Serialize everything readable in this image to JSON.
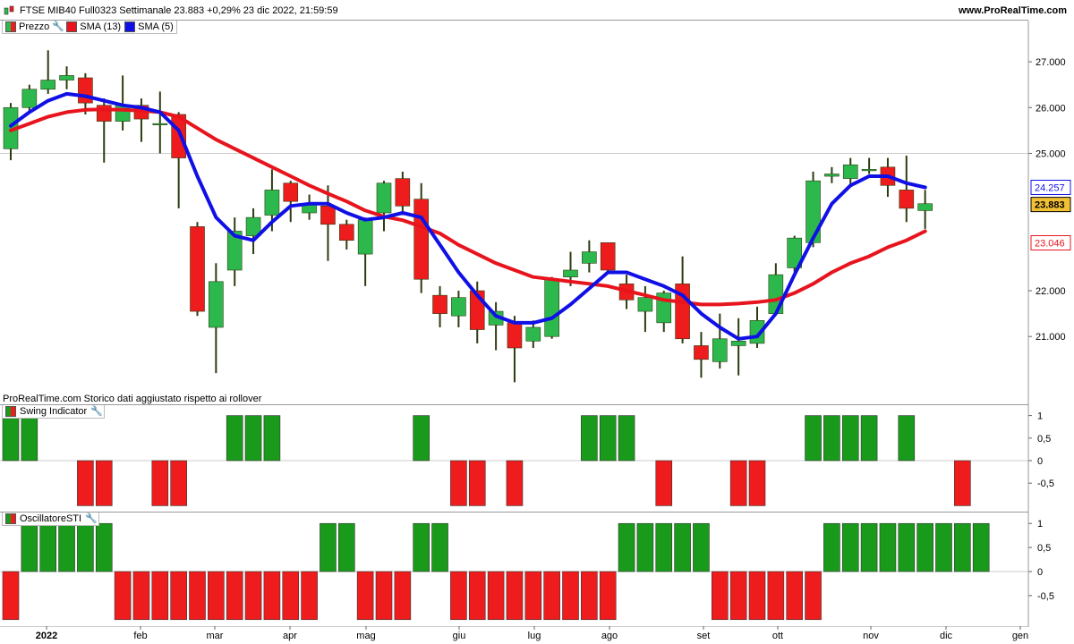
{
  "header": {
    "title": "FTSE MIB40 Full0323 Settimanale 23.883 +0,29% 23 dic 2022, 21:59:59",
    "brand": "www.ProRealTime.com"
  },
  "legend_price": {
    "price_label": "Prezzo",
    "sma13_label": "SMA (13)",
    "sma5_label": "SMA (5)"
  },
  "notice": "ProRealTime.com  Storico dati aggiustato rispetto ai rollover",
  "legend_swing": "Swing Indicator",
  "legend_osc": "OscillatoreSTI",
  "colors": {
    "up": "#2db84d",
    "down": "#ee1c1c",
    "sma13": "#e8141d",
    "sma5": "#1010e6",
    "bar_up": "#1a9a1a",
    "bar_down": "#ee1c1c"
  },
  "price_axis": {
    "ticks": [
      "27.000",
      "26.000",
      "25.000",
      "22.000",
      "21.000"
    ],
    "tick_values": [
      27000,
      26000,
      25000,
      22000,
      21000
    ],
    "last_price": "23.883",
    "sma5_last": "24.257",
    "sma13_last": "23.046"
  },
  "swing_axis": [
    "1",
    "0,5",
    "0",
    "-0,5"
  ],
  "osc_axis": [
    "1",
    "0,5",
    "0",
    "-0,5"
  ],
  "x_labels": [
    "2022",
    "feb",
    "mar",
    "apr",
    "mag",
    "giu",
    "lug",
    "ago",
    "set",
    "ott",
    "nov",
    "dic",
    "gen"
  ],
  "chart_data": [
    {
      "type": "candlestick",
      "candles": [
        {
          "o": 25100,
          "c": 26000,
          "h": 26100,
          "l": 24850
        },
        {
          "o": 26000,
          "c": 26400,
          "h": 26500,
          "l": 25900
        },
        {
          "o": 26400,
          "c": 26600,
          "h": 27250,
          "l": 26300
        },
        {
          "o": 26600,
          "c": 26700,
          "h": 26900,
          "l": 26400
        },
        {
          "o": 26650,
          "c": 26100,
          "h": 26750,
          "l": 25850
        },
        {
          "o": 26050,
          "c": 25700,
          "h": 26200,
          "l": 24800
        },
        {
          "o": 25700,
          "c": 26050,
          "h": 26700,
          "l": 25500
        },
        {
          "o": 26050,
          "c": 25750,
          "h": 26200,
          "l": 25250
        },
        {
          "o": 25650,
          "c": 25650,
          "h": 26350,
          "l": 25000
        },
        {
          "o": 25850,
          "c": 24900,
          "h": 25900,
          "l": 23800
        },
        {
          "o": 23400,
          "c": 21550,
          "h": 23500,
          "l": 21450
        },
        {
          "o": 21200,
          "c": 22200,
          "h": 22600,
          "l": 20200
        },
        {
          "o": 22450,
          "c": 23300,
          "h": 23600,
          "l": 22100
        },
        {
          "o": 23200,
          "c": 23600,
          "h": 23800,
          "l": 22800
        },
        {
          "o": 23650,
          "c": 24200,
          "h": 24650,
          "l": 23300
        },
        {
          "o": 24350,
          "c": 23950,
          "h": 24400,
          "l": 23500
        },
        {
          "o": 23700,
          "c": 23900,
          "h": 24100,
          "l": 23550
        },
        {
          "o": 23850,
          "c": 23450,
          "h": 24300,
          "l": 22650
        },
        {
          "o": 23450,
          "c": 23100,
          "h": 23550,
          "l": 22900
        },
        {
          "o": 22800,
          "c": 23550,
          "h": 23600,
          "l": 22100
        },
        {
          "o": 23700,
          "c": 24350,
          "h": 24400,
          "l": 23300
        },
        {
          "o": 24450,
          "c": 23850,
          "h": 24600,
          "l": 23650
        },
        {
          "o": 24000,
          "c": 22250,
          "h": 24350,
          "l": 21950
        },
        {
          "o": 21900,
          "c": 21500,
          "h": 22100,
          "l": 21200
        },
        {
          "o": 21450,
          "c": 21850,
          "h": 22000,
          "l": 21200
        },
        {
          "o": 22000,
          "c": 21150,
          "h": 22200,
          "l": 20850
        },
        {
          "o": 21250,
          "c": 21550,
          "h": 21750,
          "l": 20700
        },
        {
          "o": 21300,
          "c": 20750,
          "h": 21450,
          "l": 20000
        },
        {
          "o": 20900,
          "c": 21200,
          "h": 21350,
          "l": 20750
        },
        {
          "o": 21000,
          "c": 22250,
          "h": 22300,
          "l": 20950
        },
        {
          "o": 22300,
          "c": 22450,
          "h": 22850,
          "l": 22100
        },
        {
          "o": 22600,
          "c": 22850,
          "h": 23100,
          "l": 22400
        },
        {
          "o": 23050,
          "c": 22450,
          "h": 23050,
          "l": 22400
        },
        {
          "o": 22150,
          "c": 21800,
          "h": 22350,
          "l": 21600
        },
        {
          "o": 21550,
          "c": 21850,
          "h": 22100,
          "l": 21100
        },
        {
          "o": 21300,
          "c": 21950,
          "h": 22000,
          "l": 21100
        },
        {
          "o": 22150,
          "c": 20950,
          "h": 22750,
          "l": 20850
        },
        {
          "o": 20800,
          "c": 20500,
          "h": 21100,
          "l": 20100
        },
        {
          "o": 20450,
          "c": 20950,
          "h": 21500,
          "l": 20300
        },
        {
          "o": 20800,
          "c": 20900,
          "h": 21400,
          "l": 20150
        },
        {
          "o": 20850,
          "c": 21350,
          "h": 21650,
          "l": 20750
        },
        {
          "o": 21500,
          "c": 22350,
          "h": 22600,
          "l": 21500
        },
        {
          "o": 22500,
          "c": 23150,
          "h": 23200,
          "l": 22400
        },
        {
          "o": 23050,
          "c": 24400,
          "h": 24600,
          "l": 22950
        },
        {
          "o": 24500,
          "c": 24550,
          "h": 24700,
          "l": 24350
        },
        {
          "o": 24450,
          "c": 24750,
          "h": 24900,
          "l": 24300
        },
        {
          "o": 24650,
          "c": 24650,
          "h": 24900,
          "l": 24550
        },
        {
          "o": 24700,
          "c": 24300,
          "h": 24900,
          "l": 24050
        },
        {
          "o": 24200,
          "c": 23800,
          "h": 24950,
          "l": 23500
        },
        {
          "o": 23750,
          "c": 23900,
          "h": 24200,
          "l": 23350
        }
      ],
      "sma13": [
        25500,
        25650,
        25800,
        25900,
        25950,
        25960,
        25950,
        25930,
        25900,
        25800,
        25550,
        25300,
        25100,
        24900,
        24700,
        24500,
        24300,
        24120,
        23950,
        23750,
        23620,
        23540,
        23400,
        23250,
        23000,
        22800,
        22600,
        22450,
        22300,
        22250,
        22200,
        22150,
        22100,
        22000,
        21900,
        21800,
        21750,
        21700,
        21700,
        21720,
        21750,
        21800,
        21950,
        22150,
        22400,
        22600,
        22750,
        22950,
        23100,
        23300
      ],
      "sma5": [
        25600,
        25900,
        26150,
        26300,
        26250,
        26150,
        26050,
        26000,
        25900,
        25500,
        24500,
        23600,
        23200,
        23100,
        23500,
        23850,
        23900,
        23900,
        23700,
        23550,
        23600,
        23700,
        23600,
        23000,
        22400,
        21900,
        21450,
        21300,
        21300,
        21400,
        21700,
        22050,
        22400,
        22400,
        22250,
        22100,
        21900,
        21500,
        21200,
        20950,
        21000,
        21500,
        22350,
        23150,
        23900,
        24300,
        24500,
        24500,
        24350,
        24257
      ]
    },
    {
      "type": "bar",
      "name": "Swing Indicator",
      "values": [
        1,
        1,
        0,
        0,
        -1,
        -1,
        0,
        0,
        -1,
        -1,
        0,
        0,
        1,
        1,
        1,
        0,
        0,
        0,
        0,
        0,
        0,
        0,
        1,
        0,
        -1,
        -1,
        0,
        -1,
        0,
        0,
        0,
        1,
        1,
        1,
        0,
        -1,
        0,
        0,
        0,
        -1,
        -1,
        0,
        0,
        1,
        1,
        1,
        1,
        0,
        1,
        0,
        0,
        -1
      ],
      "ylim": [
        -1,
        1
      ]
    },
    {
      "type": "bar",
      "name": "OscillatoreSTI",
      "values": [
        -1,
        1,
        1,
        1,
        1,
        1,
        -1,
        -1,
        -1,
        -1,
        -1,
        -1,
        -1,
        -1,
        -1,
        -1,
        -1,
        1,
        1,
        -1,
        -1,
        -1,
        1,
        1,
        -1,
        -1,
        -1,
        -1,
        -1,
        -1,
        -1,
        -1,
        -1,
        1,
        1,
        1,
        1,
        1,
        -1,
        -1,
        -1,
        -1,
        -1,
        -1,
        1,
        1,
        1,
        1,
        1,
        1,
        1,
        1,
        1
      ],
      "ylim": [
        -1,
        1
      ]
    }
  ]
}
